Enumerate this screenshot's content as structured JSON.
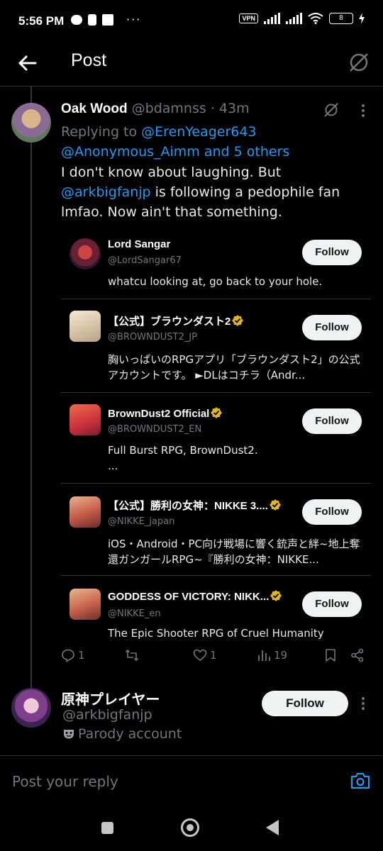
{
  "status_bar": {
    "time": "5:56 PM",
    "dots": "···",
    "vpn": "VPN",
    "battery": "8"
  },
  "header": {
    "title": "Post"
  },
  "post": {
    "author_name": "Oak Wood",
    "author_handle": "@bdamnss",
    "time": "· 43m",
    "replying_to_label": "Replying to",
    "replying_to_user1": "@ErenYeager643",
    "replying_to_user2": "@Anonymous_Aimm",
    "replying_to_more": "and 5 others",
    "text_before": "I don't know about laughing. But",
    "text_mention": "@arkbigfanjp",
    "text_after": "is following a pedophile fan lmfao. Now ain't that something."
  },
  "cards": [
    {
      "name": "Lord Sangar",
      "handle": "@LordSangar67",
      "bio": "whatcu looking at, go back to your hole.",
      "follow_label": "Follow",
      "avatar_color": "#7a2b3a"
    },
    {
      "name": "【公式】ブラウンダスト2",
      "handle": "@BROWNDUST2_JP",
      "bio": "胸いっぱいのRPGアプリ「ブラウンダスト2」の公式アカウントです。 ►DLはコチラ（Andr...",
      "follow_label": "Follow",
      "avatar_color": "#e8ddd0"
    },
    {
      "name": "BrownDust2 Official",
      "handle": "@BROWNDUST2_EN",
      "bio": "Full Burst RPG, BrownDust2.\n...",
      "follow_label": "Follow",
      "avatar_color": "#d9503a"
    },
    {
      "name": "【公式】勝利の女神：NIKKE 3....",
      "handle": "@NIKKE_japan",
      "bio": "iOS・Android・PC向け戦場に響く銃声と絆~地上奪還ガンガールRPG~『勝利の女神：NIKKE...",
      "follow_label": "Follow",
      "avatar_color": "#c9735a"
    },
    {
      "name": "GODDESS OF VICTORY: NIKK...",
      "handle": "@NIKKE_en",
      "bio": "The Epic Shooter RPG of Cruel Humanity",
      "follow_label": "Follow",
      "avatar_color": "#c97a5e"
    }
  ],
  "actions": {
    "replies": "1",
    "likes": "1",
    "views": "19"
  },
  "user2": {
    "name": "原神プレイヤー",
    "handle": "@arkbigfanjp",
    "parody_label": "Parody account",
    "follow_label": "Follow"
  },
  "reply": {
    "placeholder": "Post your reply"
  },
  "colors": {
    "accent": "#1d9bf0",
    "muted": "#71767b",
    "verified_gold": "#e2b719"
  }
}
